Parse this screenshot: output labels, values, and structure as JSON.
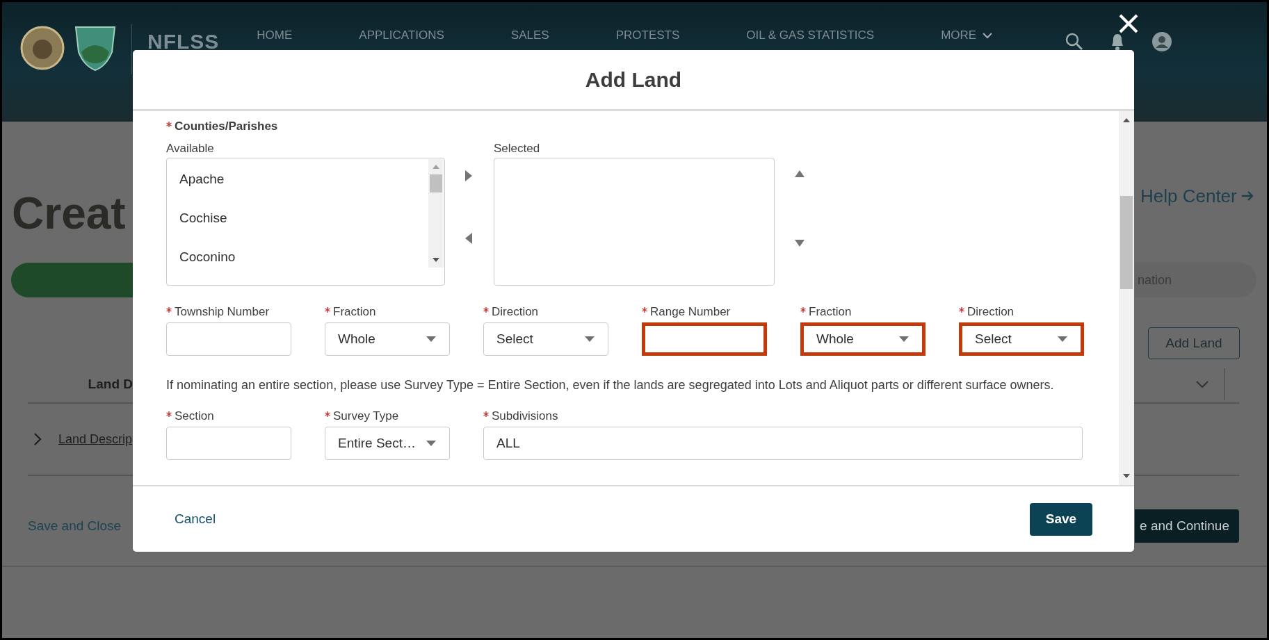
{
  "header": {
    "brand": "NFLSS",
    "nav": [
      "HOME",
      "APPLICATIONS",
      "SALES",
      "PROTESTS",
      "OIL & GAS STATISTICS"
    ],
    "more": "MORE"
  },
  "page": {
    "title": "Creat",
    "help_link": "Help Center",
    "progress_right": "nation",
    "add_button": "Add Land",
    "table": {
      "column_1": "Land D"
    },
    "row_link": "Land Descrip",
    "save_close": "Save and Close",
    "continue_button": "e and Continue"
  },
  "modal": {
    "title": "Add Land",
    "counties": {
      "label": "Counties/Parishes",
      "required": true,
      "available_label": "Available",
      "available": [
        "Apache",
        "Cochise",
        "Coconino"
      ],
      "selected_label": "Selected"
    },
    "location_fields": [
      {
        "label": "Township Number",
        "kind": "text",
        "required": true,
        "highlighted": false
      },
      {
        "label": "Fraction",
        "kind": "select",
        "value": "Whole",
        "required": true,
        "highlighted": false
      },
      {
        "label": "Direction",
        "kind": "select",
        "value": "Select",
        "required": true,
        "highlighted": false
      },
      {
        "label": "Range Number",
        "kind": "text",
        "required": true,
        "highlighted": true
      },
      {
        "label": "Fraction",
        "kind": "select",
        "value": "Whole",
        "required": true,
        "highlighted": true
      },
      {
        "label": "Direction",
        "kind": "select",
        "value": "Select",
        "required": true,
        "highlighted": true
      }
    ],
    "note": "If nominating an entire section, please use Survey Type = Entire Section, even if the lands are segregated into Lots and Aliquot parts or different surface owners.",
    "detail_fields": [
      {
        "label": "Section",
        "kind": "text",
        "required": true,
        "highlighted": false
      },
      {
        "label": "Survey Type",
        "kind": "select",
        "value": "Entire Sect…",
        "required": true,
        "highlighted": false
      },
      {
        "label": "Subdivisions",
        "kind": "wide",
        "value": "ALL",
        "required": true,
        "highlighted": false
      }
    ],
    "cancel": "Cancel",
    "save": "Save"
  }
}
